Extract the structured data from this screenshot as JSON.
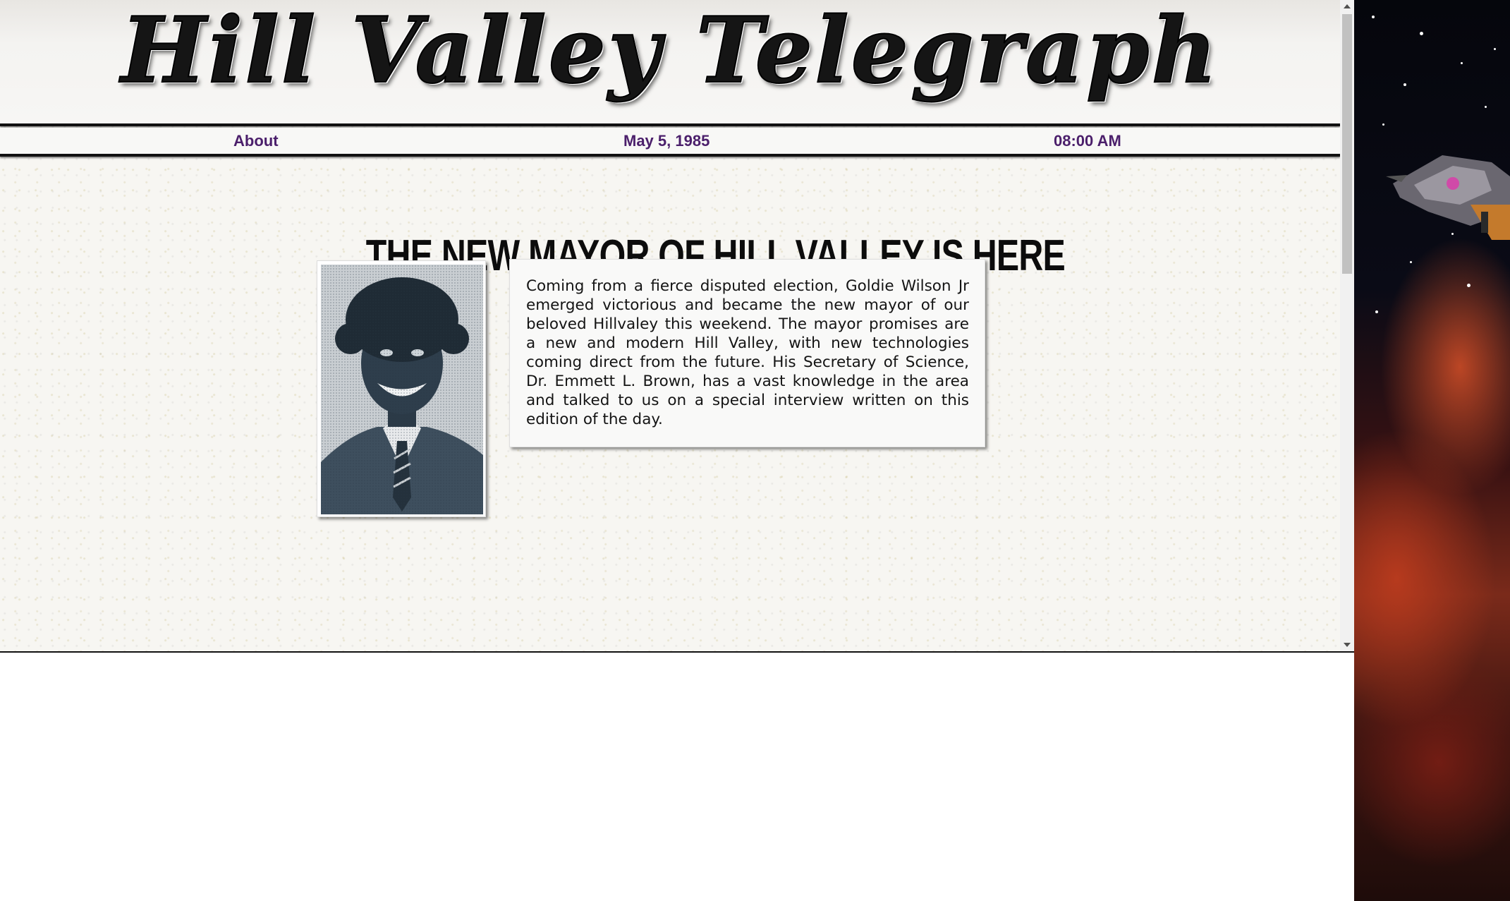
{
  "masthead": {
    "title": "Hill Valley Telegraph"
  },
  "nav": {
    "about_label": "About",
    "date": "May 5, 1985",
    "time": "08:00 AM"
  },
  "article": {
    "headline": "THE NEW MAYOR OF HILL VALLEY IS HERE",
    "body": "Coming from a fierce disputed election, Goldie Wilson Jr emerged victorious and became the new mayor of our beloved Hillvaley this weekend. The mayor promises are a new and modern Hill Valley, with new technologies coming direct from the future. His Secretary of Science, Dr. Emmett L. Brown, has a vast knowledge in the area and talked to us on a special interview written on this edition of the day."
  },
  "colors": {
    "nav_text": "#4b1f6b",
    "page_bg": "#f7f6f2",
    "rule": "#111111"
  }
}
